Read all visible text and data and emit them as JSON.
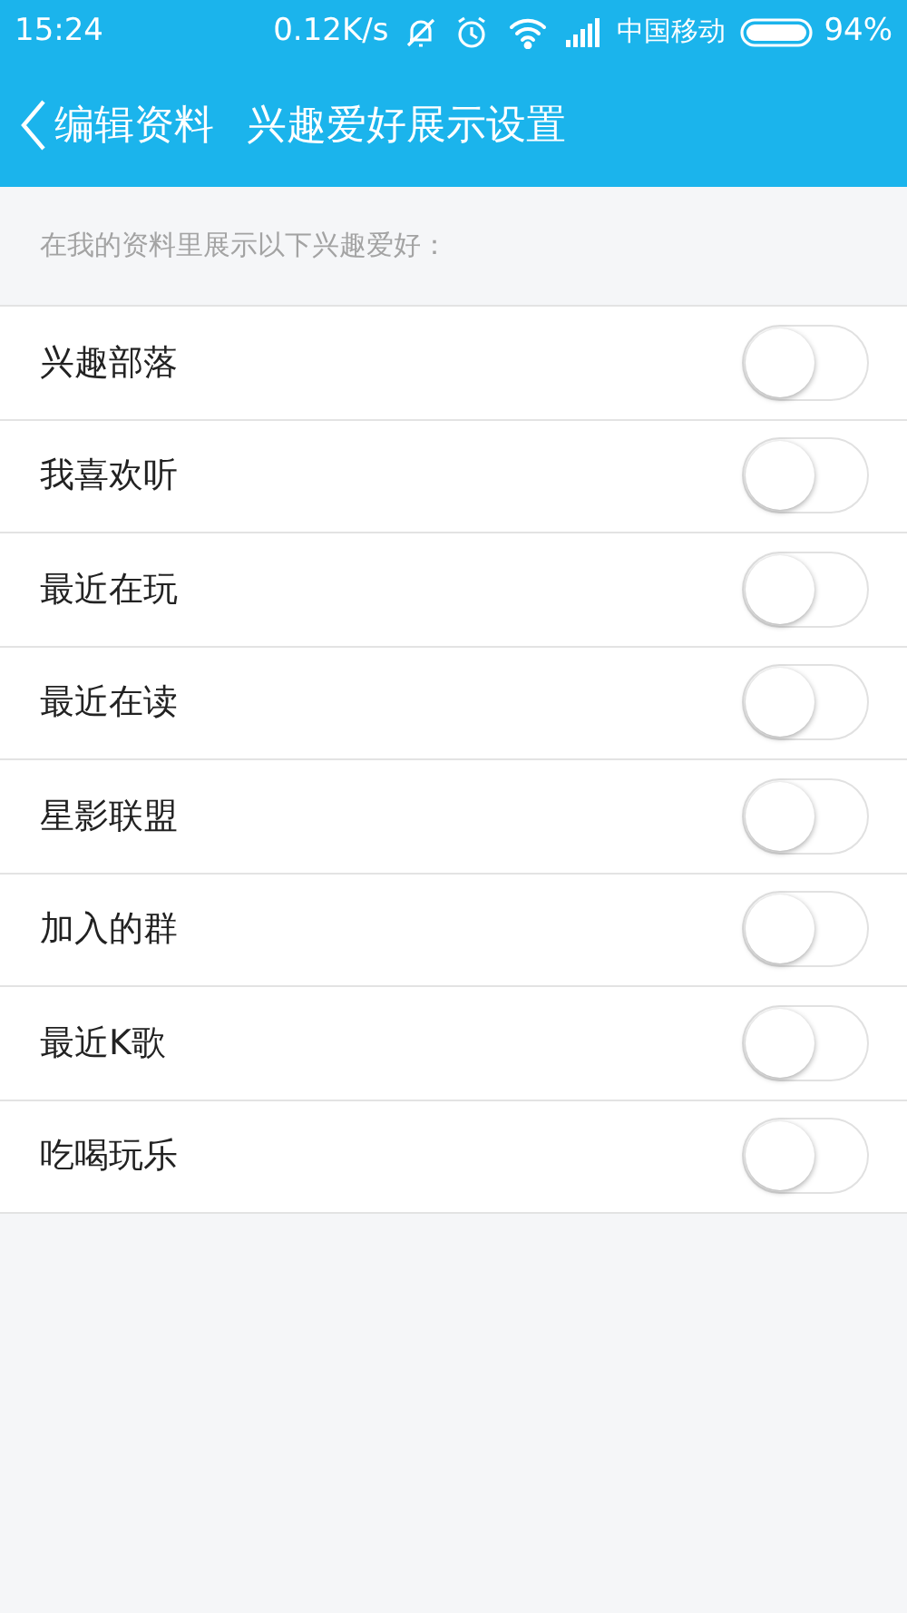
{
  "status_bar": {
    "time": "15:24",
    "speed": "0.12K/s",
    "carrier": "中国移动",
    "battery": "94%"
  },
  "header": {
    "back": "编辑资料",
    "title": "兴趣爱好展示设置"
  },
  "section_label": "在我的资料里展示以下兴趣爱好：",
  "items": [
    {
      "label": "兴趣部落",
      "on": false
    },
    {
      "label": "我喜欢听",
      "on": false
    },
    {
      "label": "最近在玩",
      "on": false
    },
    {
      "label": "最近在读",
      "on": false
    },
    {
      "label": "星影联盟",
      "on": false
    },
    {
      "label": "加入的群",
      "on": false
    },
    {
      "label": "最近K歌",
      "on": false
    },
    {
      "label": "吃喝玩乐",
      "on": false
    }
  ]
}
